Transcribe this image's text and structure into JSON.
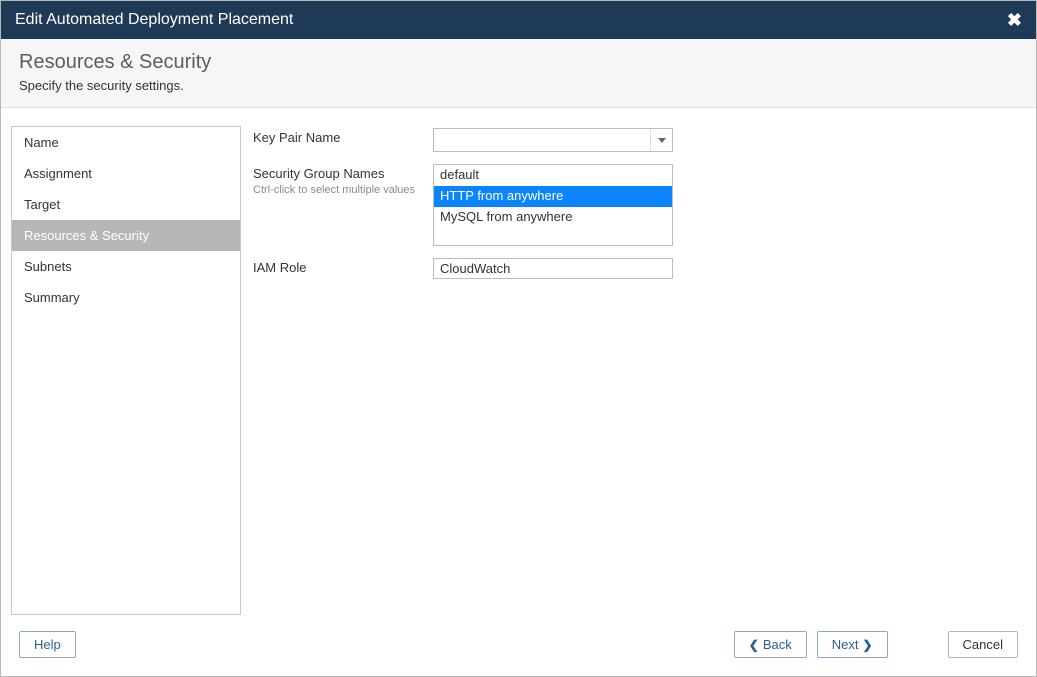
{
  "title": "Edit Automated Deployment Placement",
  "subheader": {
    "heading": "Resources & Security",
    "description": "Specify the security settings."
  },
  "sidebar": {
    "items": [
      {
        "label": "Name",
        "active": false
      },
      {
        "label": "Assignment",
        "active": false
      },
      {
        "label": "Target",
        "active": false
      },
      {
        "label": "Resources & Security",
        "active": true
      },
      {
        "label": "Subnets",
        "active": false
      },
      {
        "label": "Summary",
        "active": false
      }
    ]
  },
  "form": {
    "keyPair": {
      "label": "Key Pair Name",
      "value": ""
    },
    "securityGroups": {
      "label": "Security Group Names",
      "hint": "Ctrl-click to select multiple values",
      "options": [
        {
          "label": "default",
          "selected": false
        },
        {
          "label": "HTTP from anywhere",
          "selected": true
        },
        {
          "label": "MySQL from anywhere",
          "selected": false
        }
      ]
    },
    "iamRole": {
      "label": "IAM Role",
      "value": "CloudWatch"
    }
  },
  "footer": {
    "help": "Help",
    "back": "Back",
    "next": "Next",
    "cancel": "Cancel"
  }
}
